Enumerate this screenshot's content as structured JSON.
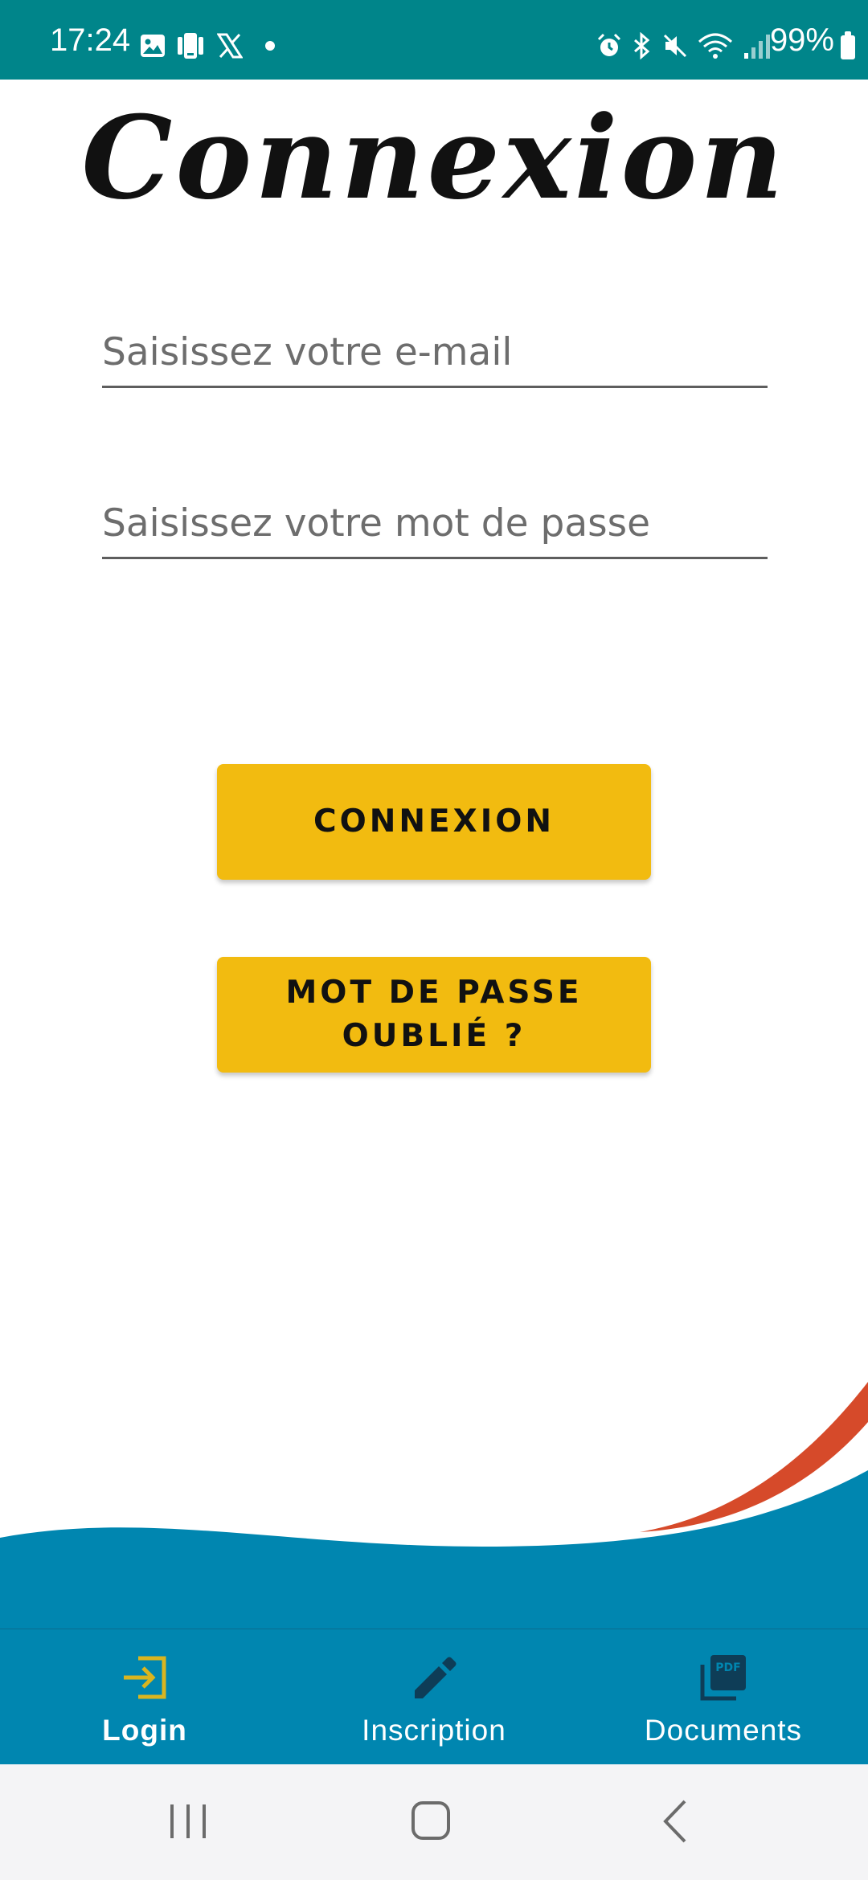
{
  "status_bar": {
    "time": "17:24",
    "battery_percent": "99%",
    "left_icons": [
      "image-icon",
      "device-sync-icon",
      "x-logo-icon",
      "dot-icon"
    ],
    "right_icons": [
      "alarm-icon",
      "bluetooth-icon",
      "mute-icon",
      "wifi-icon",
      "signal-icon",
      "battery-icon"
    ],
    "background_color": "#00858a"
  },
  "page": {
    "title": "Connexion"
  },
  "form": {
    "email_placeholder": "Saisissez votre e-mail",
    "email_value": "",
    "password_placeholder": "Saisissez votre mot de passe",
    "password_value": ""
  },
  "buttons": {
    "login_label": "CONNEXION",
    "forgot_label": "MOT DE PASSE OUBLIÉ ?",
    "color": "#f2bb10"
  },
  "bottom_nav": {
    "items": [
      {
        "label": "Login",
        "icon": "login-arrow-icon",
        "active": true
      },
      {
        "label": "Inscription",
        "icon": "pencil-icon",
        "active": false
      },
      {
        "label": "Documents",
        "icon": "pdf-documents-icon",
        "active": false
      }
    ],
    "background_color": "#0086b0",
    "active_icon_color": "#d9b520",
    "inactive_icon_color": "#0e3d57"
  },
  "system_nav": {
    "buttons": [
      "recent-apps-icon",
      "home-icon",
      "back-icon"
    ]
  },
  "decor": {
    "wave_blue": "#0086b0",
    "wave_orange": "#d64a2a"
  }
}
